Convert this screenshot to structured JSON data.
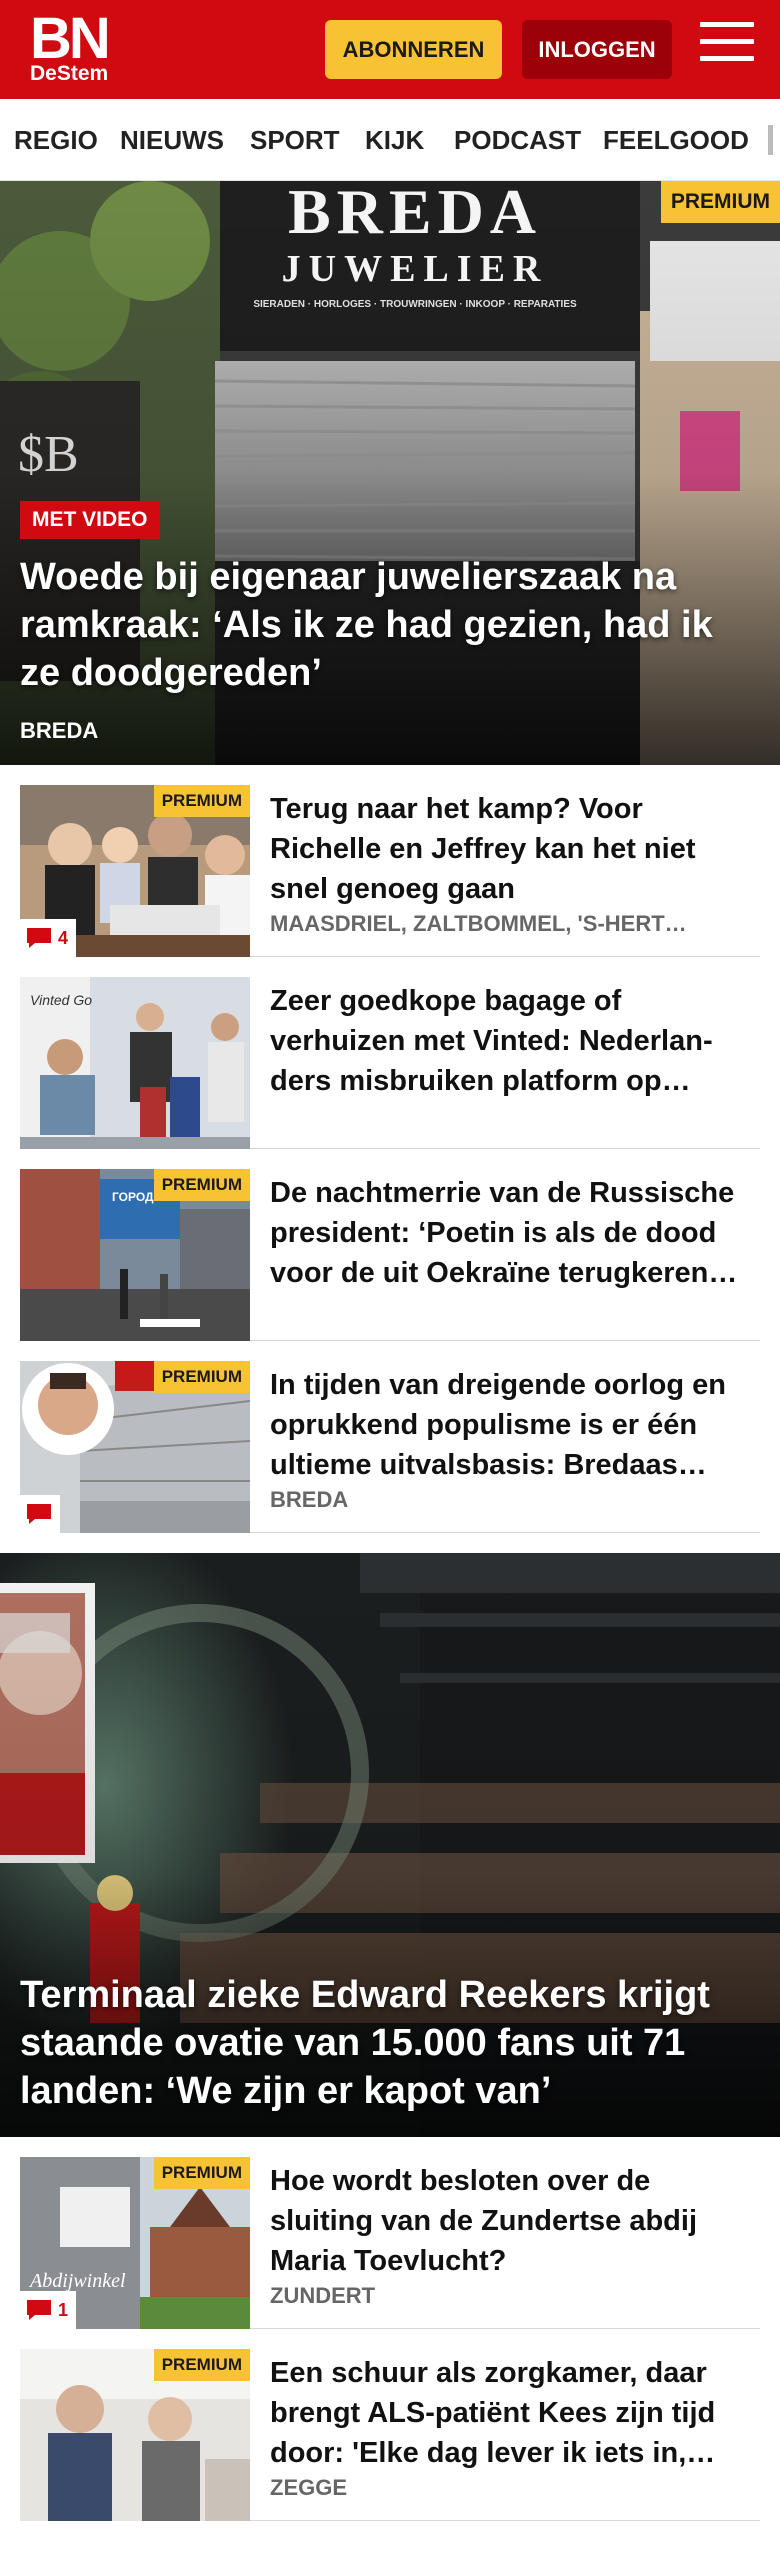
{
  "header": {
    "logo_top": "BN",
    "logo_bottom": "DeStem",
    "subscribe_label": "ABONNEREN",
    "login_label": "INLOGGEN",
    "brand_color": "#d10a11",
    "accent_color": "#f7c233"
  },
  "nav": {
    "items": [
      "REGIO",
      "NIEUWS",
      "SPORT",
      "KIJK",
      "PODCAST",
      "FEELGOOD"
    ]
  },
  "hero1": {
    "premium": "PREMIUM",
    "video_badge": "MET VIDEO",
    "title": "Woede bij eigenaar juwelierszaak na ramkraak: ‘Als ik ze had gezien, had ik ze doodgereden’",
    "location": "BREDA",
    "image_text": {
      "line1": "BREDA",
      "line2": "JUWELIER",
      "line3": "SIERADEN · HORLOGES · TROUWRINGEN · INKOOP · REPARATIES"
    }
  },
  "articles": [
    {
      "premium": "PREMIUM",
      "comments": "4",
      "title": "Terug naar het kamp? Voor Richelle en Jeffrey kan het niet snel genoeg gaan",
      "location": "MAASDRIEL, ZALTBOMMEL, 'S-HERT…"
    },
    {
      "premium": "",
      "comments": "",
      "title": "Zeer goedkope bagage of verhuizen met Vinted: Nederlan­ders misbruiken platform op…",
      "location": "",
      "image_text": "Vinted Go"
    },
    {
      "premium": "PREMIUM",
      "comments": "",
      "title": "De nachtmerrie van de Russische president: ‘Poetin is als de dood voor de uit Oekraïne terugkeren…",
      "location": "",
      "image_text": "ГОРОД РОССИИ"
    },
    {
      "premium": "PREMIUM",
      "comments": "",
      "title": "In tijden van dreigende oorlog en oprukkend populisme is er één ultieme uitvalsbasis: Bredaas…",
      "location": "BREDA"
    }
  ],
  "hero2": {
    "title": "Terminaal zieke Edward Reekers krijgt staande ovatie van 15.000 fans uit 71 landen: ‘We zijn er kapot van’"
  },
  "articles2": [
    {
      "premium": "PREMIUM",
      "comments": "1",
      "title": "Hoe wordt besloten over de sluiting van de Zundertse abdij Maria Toevlucht?",
      "location": "ZUNDERT",
      "image_text": "Abdijwinkel"
    },
    {
      "premium": "PREMIUM",
      "comments": "",
      "title": "Een schuur als zorgkamer, daar brengt ALS-patiënt Kees zijn tijd door: 'Elke dag lever ik iets in,…",
      "location": "ZEGGE"
    }
  ],
  "icons": {
    "comment": "comment-icon",
    "menu": "menu-icon"
  }
}
